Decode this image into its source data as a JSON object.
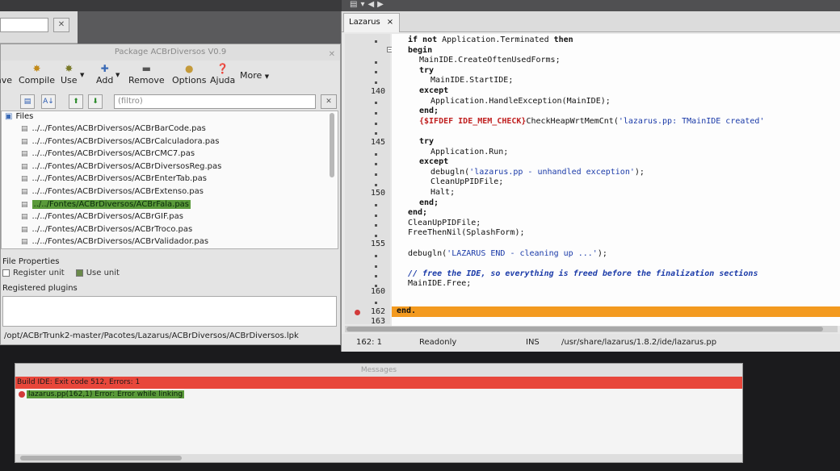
{
  "package_window": {
    "title": "Package ACBrDiversos V0.9",
    "toolbar": {
      "save": "ave",
      "compile": "Compile",
      "use": "Use",
      "add": "Add",
      "remove": "Remove",
      "options": "Options",
      "help": "Ajuda",
      "more": "More"
    },
    "filter_placeholder": "(filtro)",
    "tree_root": "Files",
    "files": [
      "../../Fontes/ACBrDiversos/ACBrBarCode.pas",
      "../../Fontes/ACBrDiversos/ACBrCalculadora.pas",
      "../../Fontes/ACBrDiversos/ACBrCMC7.pas",
      "../../Fontes/ACBrDiversos/ACBrDiversosReg.pas",
      "../../Fontes/ACBrDiversos/ACBrEnterTab.pas",
      "../../Fontes/ACBrDiversos/ACBrExtenso.pas",
      "../../Fontes/ACBrDiversos/ACBrFala.pas",
      "../../Fontes/ACBrDiversos/ACBrGIF.pas",
      "../../Fontes/ACBrDiversos/ACBrTroco.pas",
      "../../Fontes/ACBrDiversos/ACBrValidador.pas"
    ],
    "selected_index": 6,
    "file_properties": "File Properties",
    "register_unit": "Register unit",
    "use_unit": "Use unit",
    "registered_plugins": "Registered plugins",
    "path": "/opt/ACBrTrunk2-master/Pacotes/Lazarus/ACBrDiversos/ACBrDiversos.lpk"
  },
  "editor": {
    "tab_label": "Lazarus",
    "tab_close": "×",
    "status_position": "162: 1",
    "status_mode": "Readonly",
    "status_ins": "INS",
    "status_file": "/usr/share/lazarus/1.8.2/ide/lazarus.pp",
    "line_numbers": [
      "140",
      "145",
      "150",
      "155",
      "160",
      "162",
      "163"
    ],
    "code": {
      "l1_a": "if not",
      "l1_b": " Application.Terminated ",
      "l1_c": "then",
      "l2": "begin",
      "l3": "MainIDE.CreateOftenUsedForms;",
      "l4": "try",
      "l5": "MainIDE.StartIDE;",
      "l6": "except",
      "l7": "Application.HandleException(MainIDE);",
      "l8": "end;",
      "l9_dir": "{$IFDEF IDE_MEM_CHECK}",
      "l9_b": "CheckHeapWrtMemCnt(",
      "l9_str": "'lazarus.pp: TMainIDE created'",
      "l11": "try",
      "l12": "Application.Run;",
      "l13": "except",
      "l14_a": "debugln(",
      "l14_str": "'lazarus.pp - unhandled exception'",
      "l14_b": ");",
      "l15": "CleanUpPIDFile;",
      "l16": "Halt;",
      "l17": "end;",
      "l18": "end;",
      "l19": "CleanUpPIDFile;",
      "l20": "FreeThenNil(SplashForm);",
      "l22_a": "debugln(",
      "l22_str": "'LAZARUS END - cleaning up ...'",
      "l22_b": ");",
      "l24": "// free the IDE, so everything is freed before the finalization sections",
      "l25": "MainIDE.Free;",
      "l27": "end."
    }
  },
  "messages": {
    "title": "Messages",
    "build_summary": "Build IDE: Exit code 512, Errors: 1",
    "error_line": "lazarus.pp(162,1) Error: Error while linking"
  },
  "colors": {
    "error_row": "#e8473b",
    "selection_green": "#5a9a3a",
    "current_line": "#f39a1f"
  }
}
